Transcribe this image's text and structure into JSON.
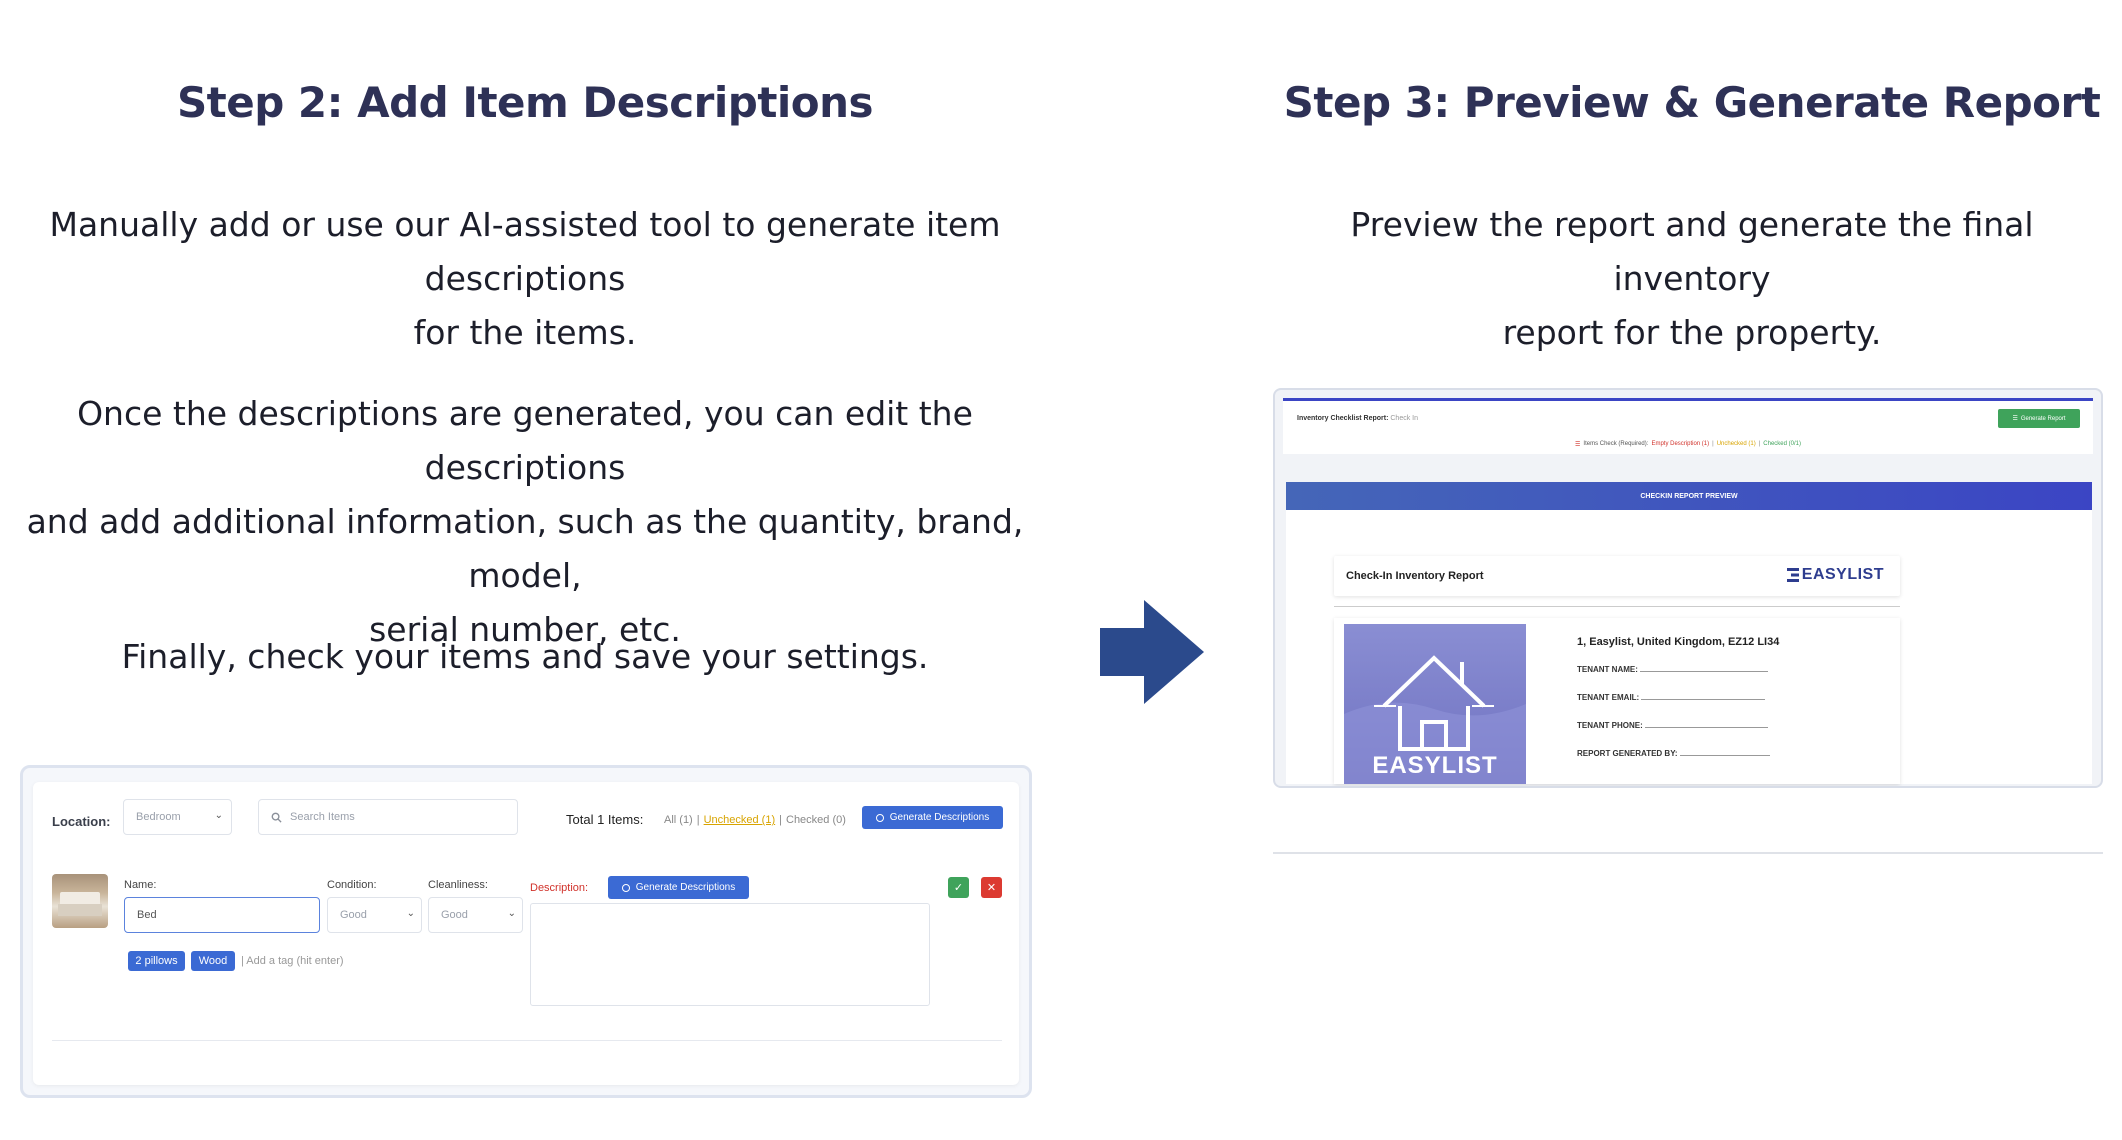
{
  "step2": {
    "title": "Step 2: Add Item Descriptions",
    "p1_line1": "Manually add or use our AI-assisted tool to generate item descriptions",
    "p1_line2": "for the items.",
    "p2_line1": "Once the descriptions are generated, you can edit the descriptions",
    "p2_line2": "and add additional information, such as the quantity, brand, model,",
    "p2_line3": "serial number, etc.",
    "p3": "Finally, check your items and save your settings."
  },
  "step3": {
    "title": "Step 3: Preview & Generate Report",
    "p1_line1": "Preview the report and generate the final inventory",
    "p1_line2": "report for the property."
  },
  "left_ui": {
    "location_label": "Location:",
    "location_value": "Bedroom",
    "search_placeholder": "Search Items",
    "total_label": "Total 1 Items:",
    "filter_all": "All (1)",
    "filter_sep1": "|",
    "filter_unchecked": "Unchecked (1)",
    "filter_sep2": "|",
    "filter_checked": "Checked (0)",
    "generate_label": "Generate Descriptions",
    "name_label": "Name:",
    "name_value": "Bed",
    "condition_label": "Condition:",
    "condition_value": "Good",
    "cleanliness_label": "Cleanliness:",
    "cleanliness_value": "Good",
    "description_label": "Description:",
    "desc_generate_label": "Generate Descriptions",
    "tags": [
      "2 pillows",
      "Wood"
    ],
    "tag_placeholder": "| Add a tag (hit enter)",
    "check_glyph": "✓",
    "close_glyph": "✕"
  },
  "right_ui": {
    "report_title": "Inventory Checklist Report:",
    "report_sub": "Check In",
    "generate_report": "Generate Report",
    "items_check_prefix": "Items Check (Required):",
    "items_check_empty": "Empty Description (1)",
    "items_check_sep1": "|",
    "items_check_unchecked": "Unchecked (1)",
    "items_check_sep2": "|",
    "items_check_checked": "Checked (0/1)",
    "preview_banner": "CHECKIN REPORT PREVIEW",
    "checkin_title": "Check-In Inventory Report",
    "logo_text": "EASYLIST",
    "address": "1, Easylist, United Kingdom, EZ12 LI34",
    "tenant_name": "TENANT NAME:",
    "tenant_email": "TENANT EMAIL:",
    "tenant_phone": "TENANT PHONE:",
    "report_by": "REPORT GENERATED BY:",
    "house_caption": "EASYLIST"
  },
  "colors": {
    "heading": "#2e3156",
    "arrow": "#2b4a8c",
    "blue_button": "#3b6ad4",
    "green_button": "#3fa35b",
    "red_button": "#dc3a31",
    "unchecked_yellow": "#d8a400",
    "banner_start": "#4566b8",
    "banner_end": "#3b45c4",
    "hero_purple": "#7f82cc"
  }
}
